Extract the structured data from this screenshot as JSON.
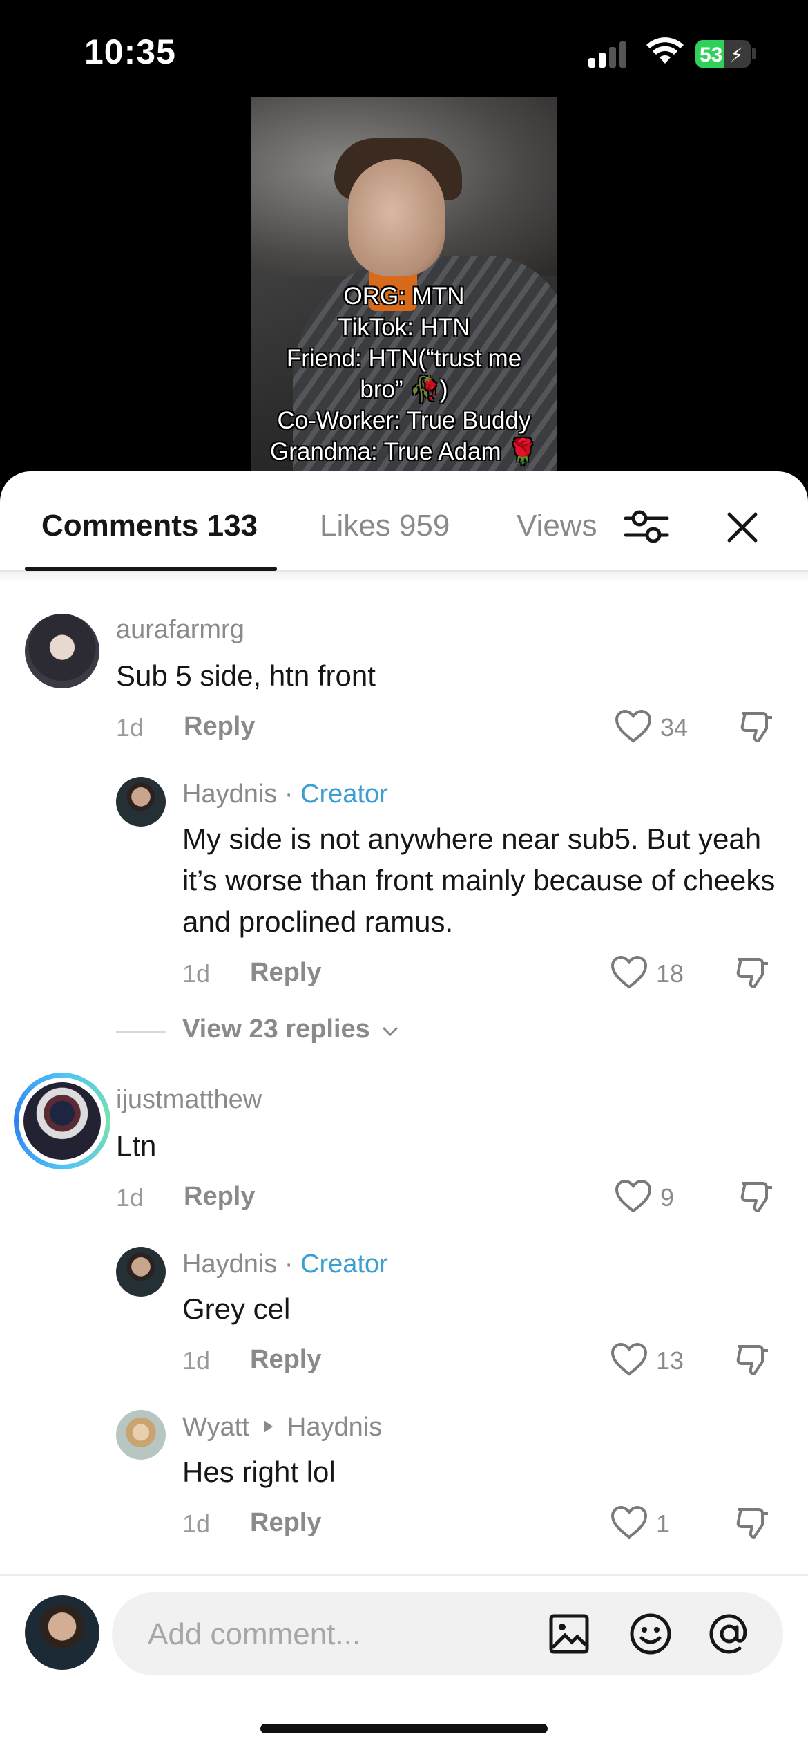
{
  "status_bar": {
    "time": "10:35",
    "battery": "53",
    "battery_level": 0.53
  },
  "video": {
    "caption_lines": [
      "ORG: MTN",
      "TikTok: HTN",
      "Friend: HTN(“trust me",
      "bro” 🥀)",
      "Co-Worker: True Buddy",
      "Grandma: True Adam 🌹"
    ]
  },
  "tabs": {
    "comments": "Comments 133",
    "likes": "Likes 959",
    "views": "Views"
  },
  "comments": [
    {
      "user": "aurafarmrg",
      "text": "Sub 5 side, htn front",
      "age": "1d",
      "reply": "Reply",
      "likes": "34"
    },
    {
      "user": "Haydnis",
      "sep": " · ",
      "tag": "Creator",
      "text": "My side is not anywhere near sub5. But yeah it’s worse than front mainly because of cheeks and proclined ramus.",
      "age": "1d",
      "reply": "Reply",
      "likes": "18"
    },
    {
      "user": "ijustmatthew",
      "text": "Ltn",
      "age": "1d",
      "reply": "Reply",
      "likes": "9"
    },
    {
      "user": "Haydnis",
      "sep": " · ",
      "tag": "Creator",
      "text": "Grey cel",
      "age": "1d",
      "reply": "Reply",
      "likes": "13"
    },
    {
      "user": "Wyatt",
      "reply_to": "Haydnis",
      "text": "Hes right lol",
      "age": "1d",
      "reply": "Reply",
      "likes": "1"
    }
  ],
  "view_replies": "View 23 replies",
  "input": {
    "placeholder": "Add comment..."
  },
  "colors": {
    "creator": "#3d9fd1",
    "text": "#161616",
    "muted": "#8a8a8a"
  }
}
